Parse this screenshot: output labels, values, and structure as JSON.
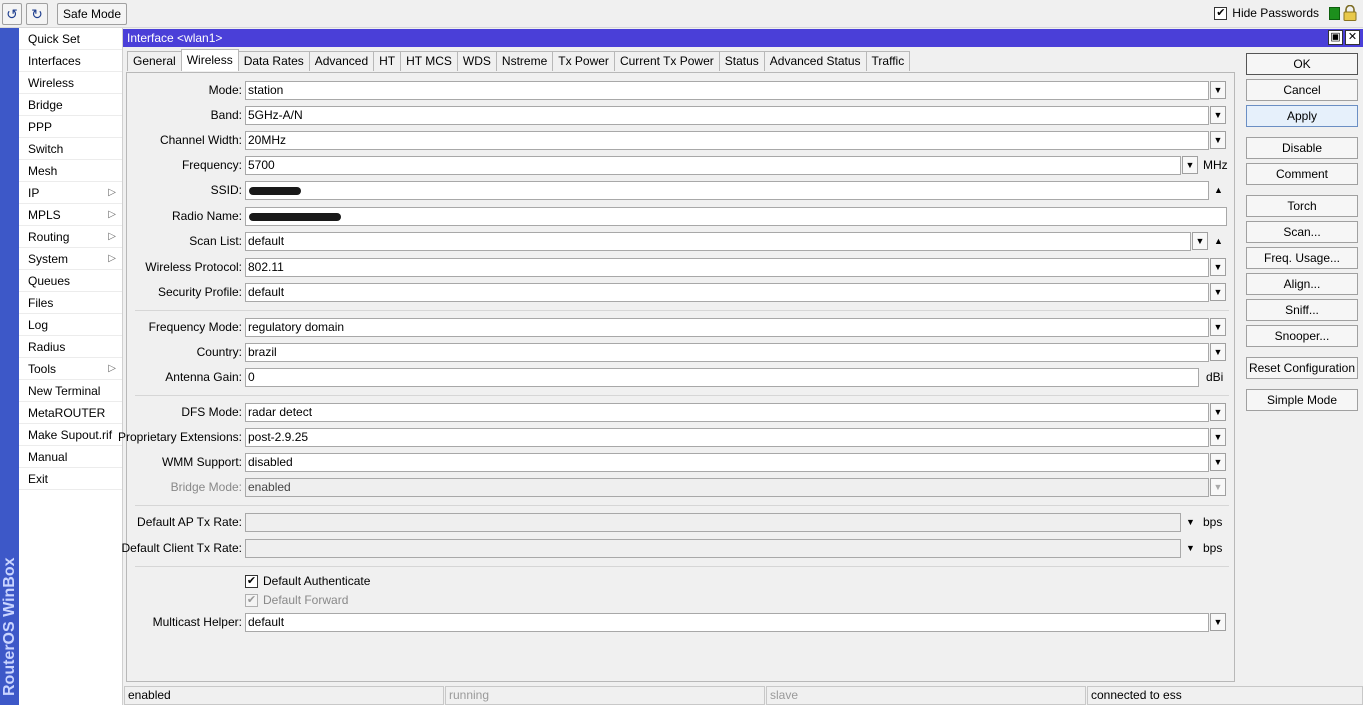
{
  "toolbar": {
    "undo_icon": "undo-icon",
    "redo_icon": "redo-icon",
    "safe_mode_label": "Safe Mode",
    "hide_passwords_label": "Hide Passwords",
    "hide_passwords_checked": true
  },
  "brand": {
    "vertical_text": "RouterOS WinBox"
  },
  "menu": {
    "items": [
      {
        "label": "Quick Set",
        "submenu": false
      },
      {
        "label": "Interfaces",
        "submenu": false
      },
      {
        "label": "Wireless",
        "submenu": false
      },
      {
        "label": "Bridge",
        "submenu": false
      },
      {
        "label": "PPP",
        "submenu": false
      },
      {
        "label": "Switch",
        "submenu": false
      },
      {
        "label": "Mesh",
        "submenu": false
      },
      {
        "label": "IP",
        "submenu": true
      },
      {
        "label": "MPLS",
        "submenu": true
      },
      {
        "label": "Routing",
        "submenu": true
      },
      {
        "label": "System",
        "submenu": true
      },
      {
        "label": "Queues",
        "submenu": false
      },
      {
        "label": "Files",
        "submenu": false
      },
      {
        "label": "Log",
        "submenu": false
      },
      {
        "label": "Radius",
        "submenu": false
      },
      {
        "label": "Tools",
        "submenu": true
      },
      {
        "label": "New Terminal",
        "submenu": false
      },
      {
        "label": "MetaROUTER",
        "submenu": false
      },
      {
        "label": "Make Supout.rif",
        "submenu": false
      },
      {
        "label": "Manual",
        "submenu": false
      },
      {
        "label": "Exit",
        "submenu": false
      }
    ]
  },
  "window": {
    "title": "Interface <wlan1>",
    "tabs": [
      "General",
      "Wireless",
      "Data Rates",
      "Advanced",
      "HT",
      "HT MCS",
      "WDS",
      "Nstreme",
      "Tx Power",
      "Current Tx Power",
      "Status",
      "Advanced Status",
      "Traffic"
    ],
    "active_tab": "Wireless"
  },
  "form": {
    "mode": {
      "label": "Mode:",
      "value": "station"
    },
    "band": {
      "label": "Band:",
      "value": "5GHz-A/N"
    },
    "channel_width": {
      "label": "Channel Width:",
      "value": "20MHz"
    },
    "frequency": {
      "label": "Frequency:",
      "value": "5700",
      "unit": "MHz"
    },
    "ssid": {
      "label": "SSID:",
      "value": "[redacted]"
    },
    "radio_name": {
      "label": "Radio Name:",
      "value": "[redacted]"
    },
    "scan_list": {
      "label": "Scan List:",
      "value": "default"
    },
    "wireless_protocol": {
      "label": "Wireless Protocol:",
      "value": "802.11"
    },
    "security_profile": {
      "label": "Security Profile:",
      "value": "default"
    },
    "frequency_mode": {
      "label": "Frequency Mode:",
      "value": "regulatory domain"
    },
    "country": {
      "label": "Country:",
      "value": "brazil"
    },
    "antenna_gain": {
      "label": "Antenna Gain:",
      "value": "0",
      "unit": "dBi"
    },
    "dfs_mode": {
      "label": "DFS Mode:",
      "value": "radar detect"
    },
    "proprietary_extensions": {
      "label": "Proprietary Extensions:",
      "value": "post-2.9.25"
    },
    "wmm_support": {
      "label": "WMM Support:",
      "value": "disabled"
    },
    "bridge_mode": {
      "label": "Bridge Mode:",
      "value": "enabled"
    },
    "default_ap_tx_rate": {
      "label": "Default AP Tx Rate:",
      "value": "",
      "unit": "bps"
    },
    "default_client_tx_rate": {
      "label": "Default Client Tx Rate:",
      "value": "",
      "unit": "bps"
    },
    "default_authenticate": {
      "label": "Default Authenticate",
      "checked": true
    },
    "default_forward": {
      "label": "Default Forward",
      "checked": true,
      "disabled": true
    },
    "multicast_helper": {
      "label": "Multicast Helper:",
      "value": "default"
    }
  },
  "actions": {
    "ok": "OK",
    "cancel": "Cancel",
    "apply": "Apply",
    "disable": "Disable",
    "comment": "Comment",
    "torch": "Torch",
    "scan": "Scan...",
    "freq_usage": "Freq. Usage...",
    "align": "Align...",
    "sniff": "Sniff...",
    "snooper": "Snooper...",
    "reset_configuration": "Reset Configuration",
    "simple_mode": "Simple Mode"
  },
  "statusbar": {
    "state": "enabled",
    "running": "running",
    "slave": "slave",
    "connection": "connected to ess"
  },
  "colors": {
    "titlebar": "#4a3fd8",
    "brand_strip": "#3d58c8"
  }
}
